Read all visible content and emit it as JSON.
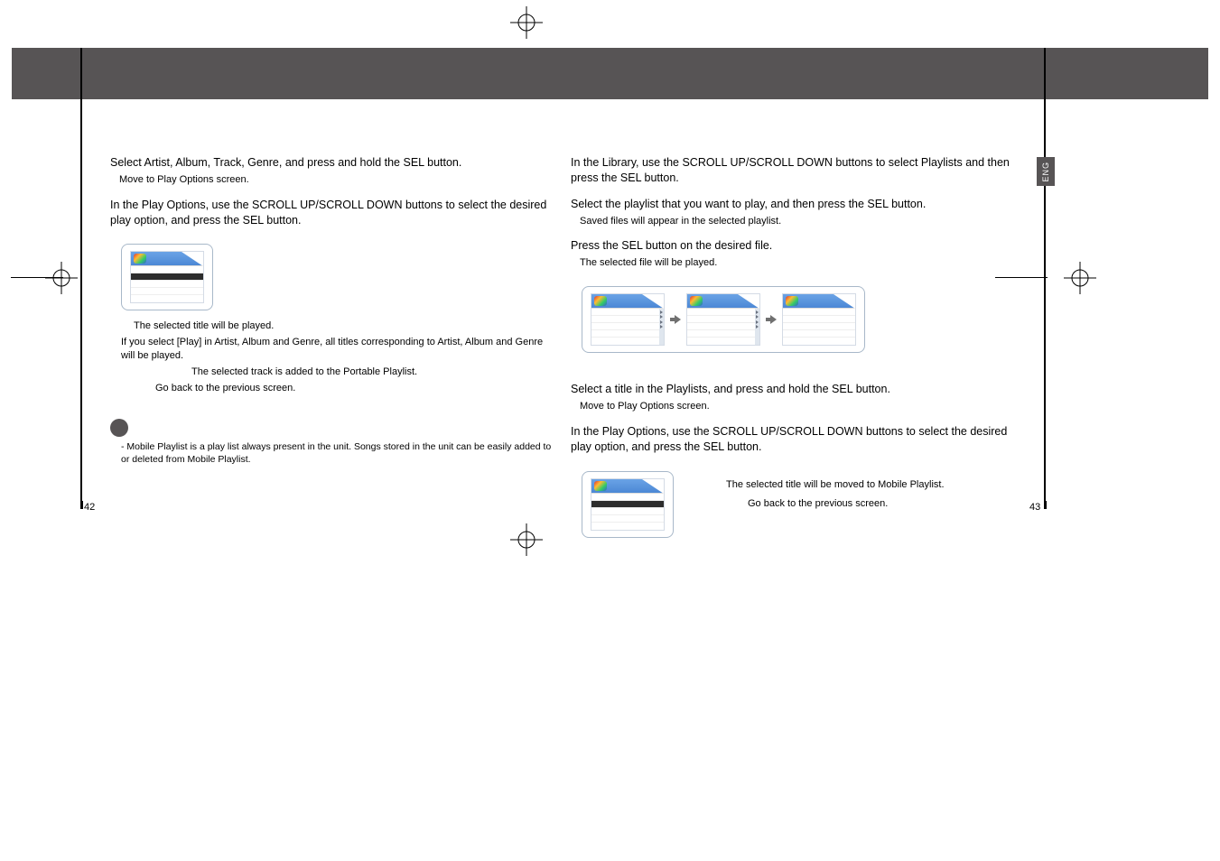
{
  "left": {
    "step3_main": "Select Artist, Album, Track, Genre, and press and hold the SEL button.",
    "step3_sub": "Move to Play Options screen.",
    "step4_main": "In the Play Options, use the SCROLL UP/SCROLL DOWN buttons to select the desired play option, and press the SEL button.",
    "opt_play": "The selected title will be played.",
    "opt_play_extra": "If you select [Play] in Artist, Album and Genre, all titles corresponding to Artist, Album and Genre will be played.",
    "opt_add_mobile": "The selected track is added to the Portable Playlist.",
    "opt_back": "Go back to the previous screen.",
    "note": "- Mobile Playlist is a play list always present in the unit. Songs stored in the unit can be easily added to or deleted from Mobile Playlist.",
    "page_num": "42"
  },
  "right": {
    "step1_main": "In the Library, use the SCROLL UP/SCROLL DOWN buttons to select Playlists and then press the SEL button.",
    "step2_main": "Select the playlist that you want to play, and then press the SEL button.",
    "step2_sub": "Saved files will appear in the selected playlist.",
    "step3_main": "Press the SEL button on the desired file.",
    "step3_sub": "The selected file will be played.",
    "opt_heading_a": "Select a title in the Playlists, and press and hold the SEL button.",
    "opt_heading_a_sub": "Move to Play Options screen.",
    "opt_heading_b": "In the Play Options, use the SCROLL UP/SCROLL DOWN buttons to select the desired play option, and press the SEL button.",
    "opt_move": "The selected title will be moved to Mobile Playlist.",
    "opt_back": "Go back to the previous screen.",
    "page_num": "43",
    "eng_label": "ENG"
  }
}
